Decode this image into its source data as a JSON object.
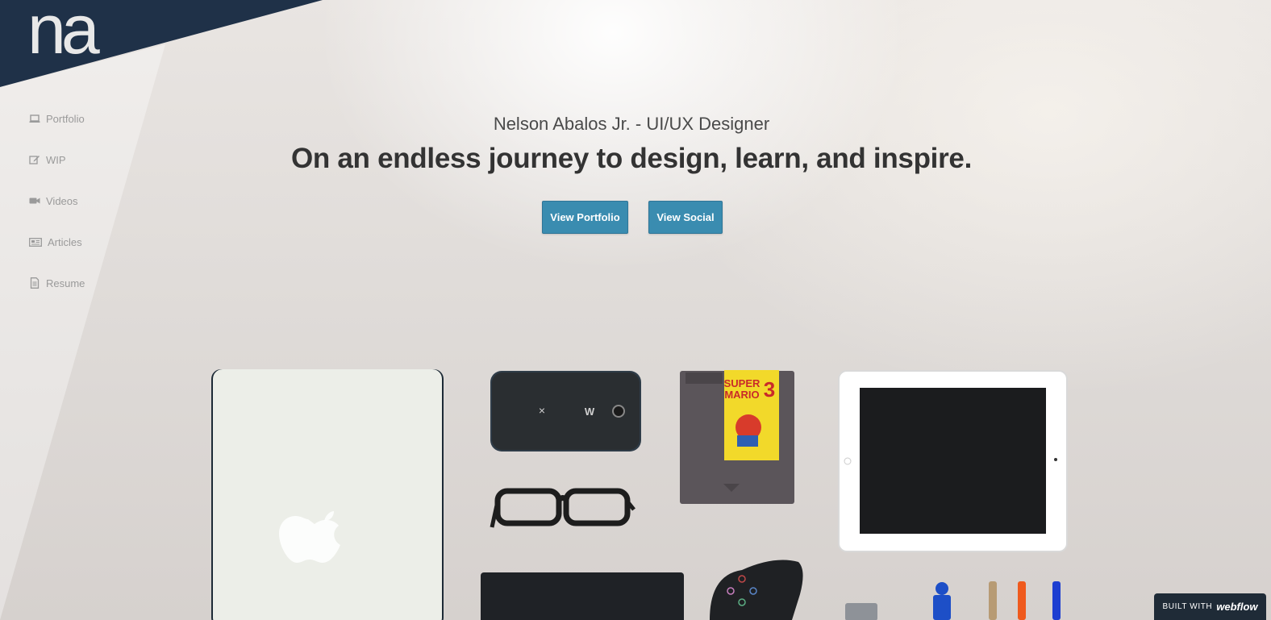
{
  "logo": {
    "text": "na"
  },
  "nav": [
    {
      "label": "Portfolio",
      "icon": "laptop-icon"
    },
    {
      "label": "WIP",
      "icon": "edit-icon"
    },
    {
      "label": "Videos",
      "icon": "video-camera-icon"
    },
    {
      "label": "Articles",
      "icon": "newspaper-icon"
    },
    {
      "label": "Resume",
      "icon": "document-icon"
    }
  ],
  "hero": {
    "subtitle": "Nelson Abalos Jr. - UI/UX Designer",
    "headline": "On an endless journey to design, learn, and inspire.",
    "buttons": {
      "portfolio": "View Portfolio",
      "social": "View Social"
    }
  },
  "cartridge": {
    "title_line1": "SUPER",
    "title_line2": "MARIO",
    "number": "3"
  },
  "badge": {
    "prefix": "BUILT WITH",
    "brand": "webflow"
  },
  "colors": {
    "navy": "#1f3148",
    "button": "#3a8cb0",
    "nav_text": "#9a9a9a",
    "headline": "#333333"
  }
}
